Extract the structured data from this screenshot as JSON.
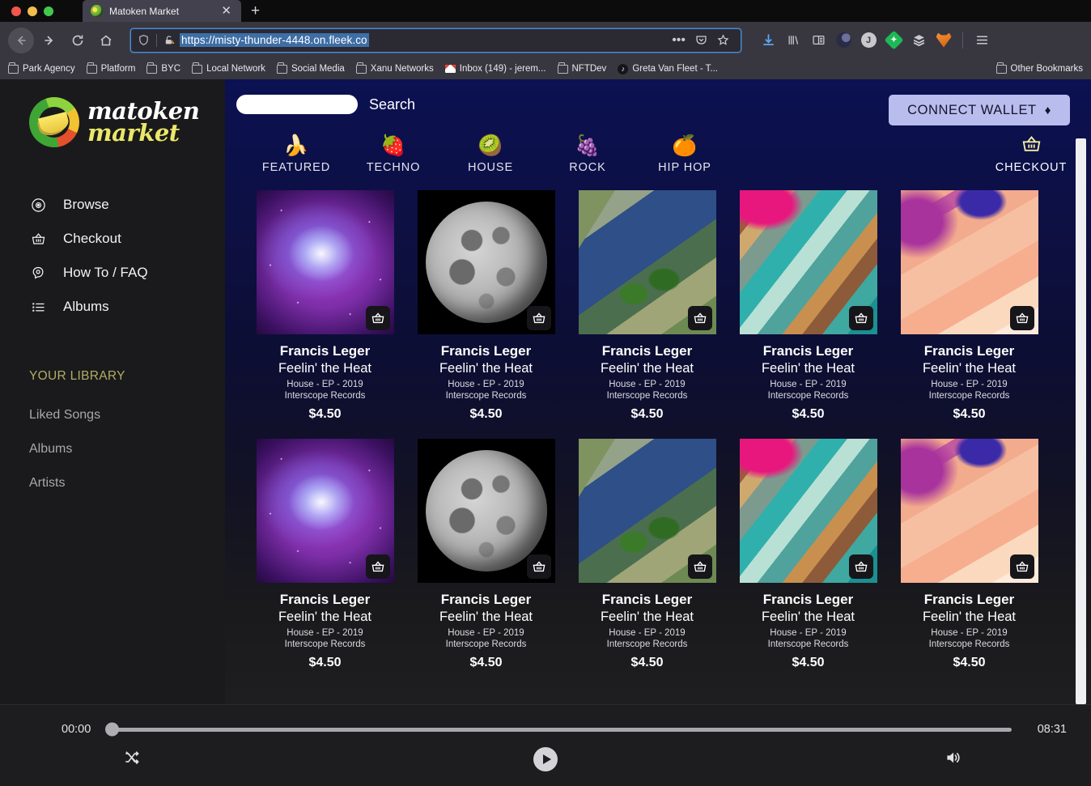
{
  "browser": {
    "tab": {
      "title": "Matoken Market",
      "close_label": "✕",
      "favicon": "matoken-favicon"
    },
    "new_tab_label": "+",
    "url": "https://misty-thunder-4448.on.fleek.co",
    "nav": {
      "back": "back-arrow",
      "forward": "forward-arrow",
      "reload": "reload-icon",
      "home": "home-icon"
    },
    "url_icons": {
      "shield": "shield-icon",
      "lock_warning": "🔓",
      "more": "•••",
      "pocket": "pocket-icon",
      "bookmark": "star-icon"
    },
    "toolbar_icons": [
      "download-icon",
      "library-icon",
      "reader-view-icon",
      "extension-swirl",
      "extension-clock",
      "extension-diamond",
      "extension-layers",
      "metamask-fox",
      "hamburger-menu"
    ],
    "extension_clock_letter": "J",
    "bookmarks": [
      {
        "label": "Park Agency",
        "icon": "folder"
      },
      {
        "label": "Platform",
        "icon": "folder"
      },
      {
        "label": "BYC",
        "icon": "folder"
      },
      {
        "label": "Local Network",
        "icon": "folder"
      },
      {
        "label": "Social Media",
        "icon": "folder"
      },
      {
        "label": "Xanu Networks",
        "icon": "folder"
      },
      {
        "label": "Inbox (149) - jerem...",
        "icon": "gmail"
      },
      {
        "label": "NFTDev",
        "icon": "folder"
      },
      {
        "label": "Greta Van Fleet - T...",
        "icon": "gvf"
      }
    ],
    "other_bookmarks": "Other Bookmarks"
  },
  "sidebar": {
    "logo": {
      "line1": "matoken",
      "line2": "market"
    },
    "nav_items": [
      {
        "label": "Browse",
        "icon": "disc-icon"
      },
      {
        "label": "Checkout",
        "icon": "basket-icon"
      },
      {
        "label": "How To / FAQ",
        "icon": "help-head-icon"
      },
      {
        "label": "Albums",
        "icon": "list-icon"
      }
    ],
    "library_title": "YOUR LIBRARY",
    "library_items": [
      {
        "label": "Liked Songs"
      },
      {
        "label": "Albums"
      },
      {
        "label": "Artists"
      }
    ]
  },
  "header": {
    "search_value": "",
    "search_placeholder": "",
    "search_label": "Search",
    "connect_wallet": "CONNECT WALLET",
    "eth_glyph": "♦"
  },
  "categories": [
    {
      "label": "FEATURED",
      "emoji": "🍌"
    },
    {
      "label": "TECHNO",
      "emoji": "🍓"
    },
    {
      "label": "HOUSE",
      "emoji": "🥝"
    },
    {
      "label": "ROCK",
      "emoji": "🍇"
    },
    {
      "label": "HIP HOP",
      "emoji": "🍊"
    }
  ],
  "checkout_top": {
    "label": "CHECKOUT",
    "icon": "basket-icon"
  },
  "albums": [
    {
      "artist": "Francis Leger",
      "title": "Feelin' the Heat",
      "meta": "House - EP - 2019",
      "label": "Interscope Records",
      "price": "$4.50",
      "art": "art-nebula"
    },
    {
      "artist": "Francis Leger",
      "title": "Feelin' the Heat",
      "meta": "House - EP - 2019",
      "label": "Interscope Records",
      "price": "$4.50",
      "art": "art-moon"
    },
    {
      "artist": "Francis Leger",
      "title": "Feelin' the Heat",
      "meta": "House - EP - 2019",
      "label": "Interscope Records",
      "price": "$4.50",
      "art": "art-delta"
    },
    {
      "artist": "Francis Leger",
      "title": "Feelin' the Heat",
      "meta": "House - EP - 2019",
      "label": "Interscope Records",
      "price": "$4.50",
      "art": "art-mineral"
    },
    {
      "artist": "Francis Leger",
      "title": "Feelin' the Heat",
      "meta": "House - EP - 2019",
      "label": "Interscope Records",
      "price": "$4.50",
      "art": "art-dune"
    },
    {
      "artist": "Francis Leger",
      "title": "Feelin' the Heat",
      "meta": "House - EP - 2019",
      "label": "Interscope Records",
      "price": "$4.50",
      "art": "art-nebula"
    },
    {
      "artist": "Francis Leger",
      "title": "Feelin' the Heat",
      "meta": "House - EP - 2019",
      "label": "Interscope Records",
      "price": "$4.50",
      "art": "art-moon"
    },
    {
      "artist": "Francis Leger",
      "title": "Feelin' the Heat",
      "meta": "House - EP - 2019",
      "label": "Interscope Records",
      "price": "$4.50",
      "art": "art-delta"
    },
    {
      "artist": "Francis Leger",
      "title": "Feelin' the Heat",
      "meta": "House - EP - 2019",
      "label": "Interscope Records",
      "price": "$4.50",
      "art": "art-mineral"
    },
    {
      "artist": "Francis Leger",
      "title": "Feelin' the Heat",
      "meta": "House - EP - 2019",
      "label": "Interscope Records",
      "price": "$4.50",
      "art": "art-dune"
    }
  ],
  "player": {
    "current_time": "00:00",
    "duration": "08:31",
    "progress_percent": 0,
    "shuffle_icon": "shuffle-icon",
    "play_icon": "play-icon",
    "volume_icon": "volume-icon"
  },
  "colors": {
    "accent_yellow": "#eae76a",
    "wallet_button": "#b9bdee",
    "page_top": "#0b1152",
    "sidebar": "#1a1a1c",
    "library_heading": "#b2ad66"
  }
}
